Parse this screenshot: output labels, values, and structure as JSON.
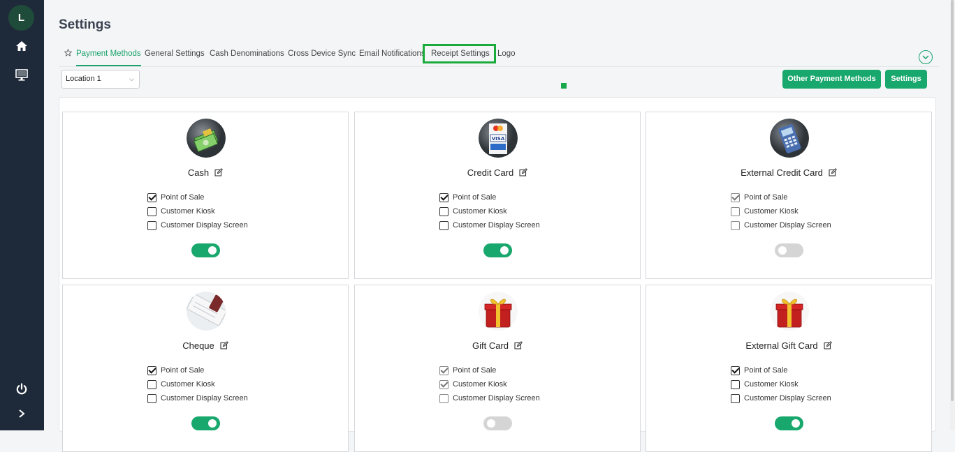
{
  "sidebar": {
    "avatar_letter": "L",
    "icons": [
      "home-icon",
      "monitor-icon",
      "power-icon",
      "chevron-right-icon"
    ]
  },
  "page": {
    "title": "Settings"
  },
  "tabs": [
    {
      "label": "Payment Methods",
      "active": true
    },
    {
      "label": "General Settings",
      "active": false
    },
    {
      "label": "Cash Denominations",
      "active": false
    },
    {
      "label": "Cross Device Sync",
      "active": false
    },
    {
      "label": "Email Notifications",
      "active": false
    },
    {
      "label": "Receipt Settings",
      "active": false
    },
    {
      "label": "Logo",
      "active": false
    }
  ],
  "location": {
    "selected": "Location 1"
  },
  "buttons": {
    "other_payment_methods": "Other Payment Methods",
    "settings": "Settings"
  },
  "option_labels": [
    "Point of Sale",
    "Customer Kiosk",
    "Customer Display Screen"
  ],
  "accent_color": "#18a76c",
  "cards": [
    {
      "title": "Cash",
      "icon": "cash-icon",
      "enabled": true,
      "options": [
        {
          "checked": true,
          "disabled": false
        },
        {
          "checked": false,
          "disabled": false
        },
        {
          "checked": false,
          "disabled": false
        }
      ]
    },
    {
      "title": "Credit Card",
      "icon": "credit-card-icon",
      "enabled": true,
      "options": [
        {
          "checked": true,
          "disabled": false
        },
        {
          "checked": false,
          "disabled": false
        },
        {
          "checked": false,
          "disabled": false
        }
      ]
    },
    {
      "title": "External Credit Card",
      "icon": "card-terminal-icon",
      "enabled": false,
      "options": [
        {
          "checked": true,
          "disabled": true
        },
        {
          "checked": false,
          "disabled": true
        },
        {
          "checked": false,
          "disabled": true
        }
      ]
    },
    {
      "title": "Cheque",
      "icon": "cheque-icon",
      "enabled": true,
      "options": [
        {
          "checked": true,
          "disabled": false
        },
        {
          "checked": false,
          "disabled": false
        },
        {
          "checked": false,
          "disabled": false
        }
      ]
    },
    {
      "title": "Gift Card",
      "icon": "gift-icon",
      "enabled": false,
      "options": [
        {
          "checked": true,
          "disabled": true
        },
        {
          "checked": true,
          "disabled": true
        },
        {
          "checked": false,
          "disabled": true
        }
      ]
    },
    {
      "title": "External Gift Card",
      "icon": "gift-icon",
      "enabled": true,
      "options": [
        {
          "checked": true,
          "disabled": false
        },
        {
          "checked": false,
          "disabled": false
        },
        {
          "checked": false,
          "disabled": false
        }
      ]
    }
  ]
}
